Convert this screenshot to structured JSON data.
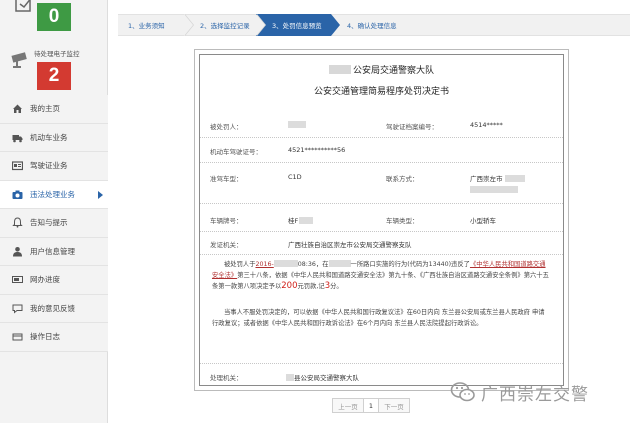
{
  "sidebar": {
    "widget_top": {
      "count": "0"
    },
    "widget_pending": {
      "label": "待处理电子监控",
      "count": "2"
    },
    "menu": [
      {
        "label": "我的主页",
        "icon": "home-icon"
      },
      {
        "label": "机动车业务",
        "icon": "truck-icon"
      },
      {
        "label": "驾驶证业务",
        "icon": "card-icon"
      },
      {
        "label": "违法处理业务",
        "icon": "camera-icon",
        "active": true
      },
      {
        "label": "告知与提示",
        "icon": "bell-icon"
      },
      {
        "label": "用户信息管理",
        "icon": "user-icon"
      },
      {
        "label": "网办进度",
        "icon": "progress-icon"
      },
      {
        "label": "我的意见反馈",
        "icon": "feedback-icon"
      },
      {
        "label": "操作日志",
        "icon": "log-icon"
      }
    ]
  },
  "steps": [
    {
      "label": "1、业务须知"
    },
    {
      "label": "2、选择监控记录"
    },
    {
      "label": "3、处罚信息预览",
      "active": true
    },
    {
      "label": "4、确认处理信息"
    }
  ],
  "document": {
    "title_line1": "公安局交通警察大队",
    "title_line2": "公安交通管理简易程序处罚决定书",
    "fields": {
      "violator_label": "被处罚人：",
      "license_no_label": "驾驶证档案编号：",
      "license_no_value": "4514*****",
      "vehicle_license_label": "机动车驾驶证号：",
      "vehicle_license_value": "4521**********56",
      "class_label": "准驾车型：",
      "class_value": "C1D",
      "contact_label": "联系方式：",
      "contact_value": "广西崇左市",
      "plate_label": "车辆牌号：",
      "plate_value": "桂F",
      "vtype_label": "车辆类型：",
      "vtype_value": "小型轿车",
      "issuer_label": "发证机关：",
      "issuer_value": "广西壮族自治区崇左市公安局交通警察支队"
    },
    "paragraph1": {
      "p1": "被处罚人于",
      "date_prefix": "2016-",
      "p2": "08:36，在",
      "p3": "一所路口实施的行为(代码为13440)违反了",
      "law1": "《中华人民共和国道路交通安全法》",
      "p4": "第三十八条，依据《中华人民共和国道路交通安全法》第九十条、《广西壮族自治区道路交通安全条例》第六十五条第一款第八项决定予以",
      "fine": "200",
      "p5": "元罚款,记",
      "points": "3",
      "p6": "分。"
    },
    "paragraph2": "当事人不服处罚决定的，可以依据《中华人民共和国行政复议法》在60日内向 东兰县公安局或东兰县人民政府 申请行政复议；或者依据《中华人民共和国行政诉讼法》在6个月内向 东兰县人民法院提起行政诉讼。",
    "authority_label": "处理机关：",
    "authority_value": "县公安局交通警察大队"
  },
  "pagination": {
    "prev": "上一页",
    "page": "1",
    "next": "下一页"
  },
  "watermark": {
    "text": "广西崇左交警"
  },
  "colors": {
    "accent": "#2a64a8",
    "green": "#3e9a44",
    "red": "#d33a31",
    "fine_red": "#d0201a"
  }
}
